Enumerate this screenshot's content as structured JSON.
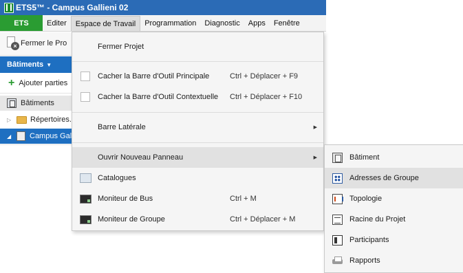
{
  "window": {
    "title": "ETS5™ - Campus Gallieni 02"
  },
  "menubar": {
    "ets_label": "ETS",
    "items": [
      "Editer",
      "Espace de Travail",
      "Programmation",
      "Diagnostic",
      "Apps",
      "Fenêtre"
    ]
  },
  "toolbar": {
    "close_project_label": "Fermer le Pro"
  },
  "panel": {
    "header_label": "Bâtiments",
    "add_parts_label": "Ajouter parties",
    "tree_header_label": "Bâtiments",
    "tree_items": [
      {
        "label": "Répertoires."
      },
      {
        "label": "Campus Gal"
      }
    ]
  },
  "dropdown": {
    "close_project": "Fermer Projet",
    "hide_main_toolbar": {
      "label": "Cacher la Barre d'Outil Principale",
      "shortcut": "Ctrl + Déplacer + F9"
    },
    "hide_context_toolbar": {
      "label": "Cacher la Barre d'Outil Contextuelle",
      "shortcut": "Ctrl + Déplacer + F10"
    },
    "side_bar": "Barre Latérale",
    "open_new_panel": "Ouvrir Nouveau Panneau",
    "catalogs": "Catalogues",
    "bus_monitor": {
      "label": "Moniteur de Bus",
      "shortcut": "Ctrl + M"
    },
    "group_monitor": {
      "label": "Moniteur de Groupe",
      "shortcut": "Ctrl + Déplacer + M"
    }
  },
  "submenu": {
    "items": [
      "Bâtiment",
      "Adresses de Groupe",
      "Topologie",
      "Racine du Projet",
      "Participants",
      "Rapports"
    ]
  }
}
